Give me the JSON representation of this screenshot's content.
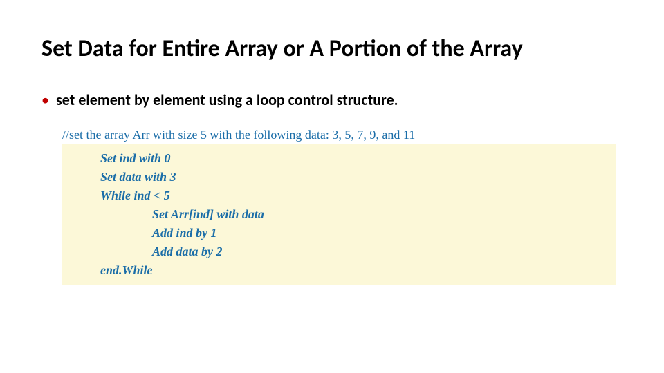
{
  "title": "Set Data  for Entire Array or A  Portion of the Array",
  "bullet": {
    "marker": "•",
    "text": "set element by element using a loop control structure."
  },
  "code": {
    "comment": "//set the array Arr with size 5 with the following data: 3, 5, 7, 9, and 11",
    "lines": [
      {
        "text": "Set ind with 0",
        "indent": 1
      },
      {
        "text": "Set data with 3",
        "indent": 1
      },
      {
        "text": "While ind <  5",
        "indent": 1
      },
      {
        "text": "Set Arr[ind] with data",
        "indent": 2
      },
      {
        "text": "Add  ind by 1",
        "indent": 2
      },
      {
        "text": "Add data by 2",
        "indent": 2
      },
      {
        "text": "end.While",
        "indent": 1
      }
    ]
  }
}
